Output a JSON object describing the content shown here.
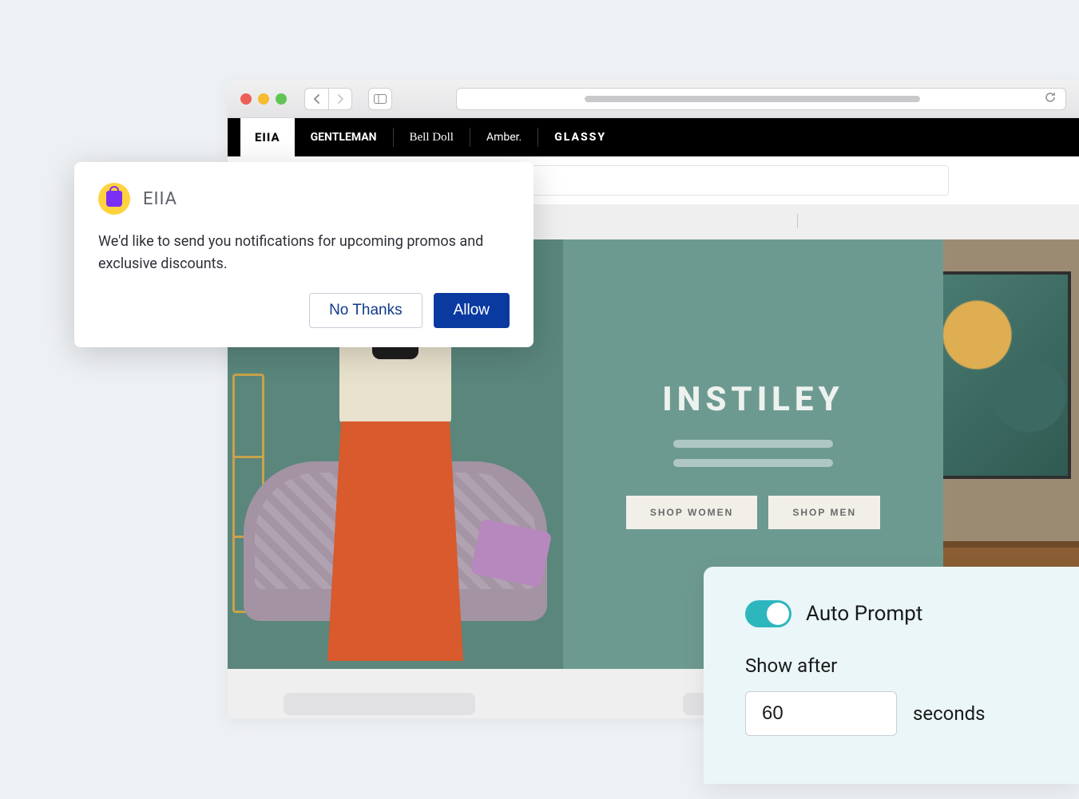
{
  "nav": {
    "logo": "EIIA",
    "items": [
      "GENTLEMAN",
      "Bell Doll",
      "Amber.",
      "GLASSY"
    ]
  },
  "hero": {
    "title": "INSTILEY",
    "shop_women": "SHOP WOMEN",
    "shop_men": "SHOP MEN"
  },
  "popover": {
    "app": "EIIA",
    "message": "We'd like to send you notifications for upcoming promos and exclusive discounts.",
    "deny": "No Thanks",
    "allow": "Allow"
  },
  "settings": {
    "toggle_label": "Auto Prompt",
    "sub_label": "Show after",
    "value": "60",
    "unit": "seconds"
  }
}
